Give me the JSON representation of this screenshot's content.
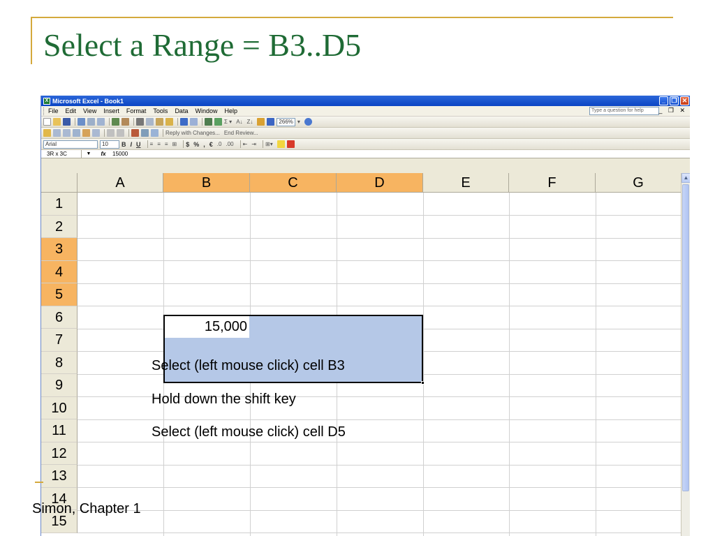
{
  "slide": {
    "title": "Select a Range = B3..D5",
    "footer": "Simon, Chapter 1"
  },
  "window": {
    "title": "Microsoft Excel - Book1",
    "help_placeholder": "Type a question for help"
  },
  "menu": {
    "items": [
      "File",
      "Edit",
      "View",
      "Insert",
      "Format",
      "Tools",
      "Data",
      "Window",
      "Help"
    ]
  },
  "toolbar": {
    "zoom": "266%",
    "reply_with_changes": "Reply with Changes...",
    "end_review": "End Review...",
    "font_name": "Arial",
    "font_size": "10",
    "bold": "B",
    "italic": "I",
    "underline": "U",
    "currency": "$",
    "percent": "%",
    "euro": "€"
  },
  "formula_bar": {
    "name_box": "3R x 3C",
    "fx": "fx",
    "value": "15000"
  },
  "sheet": {
    "columns": [
      "A",
      "B",
      "C",
      "D",
      "E",
      "F",
      "G"
    ],
    "rows": [
      "1",
      "2",
      "3",
      "4",
      "5",
      "6",
      "7",
      "8",
      "9",
      "10",
      "11",
      "12",
      "13",
      "14",
      "15"
    ],
    "selected_columns": [
      "B",
      "C",
      "D"
    ],
    "selected_rows": [
      "3",
      "4",
      "5"
    ],
    "selection_range": "B3..D5",
    "cell_b3": "15,000"
  },
  "instructions": [
    "Select (left mouse click) cell B3",
    "Hold down the shift key",
    "Select (left mouse click) cell D5"
  ],
  "colors": {
    "title_green": "#1f6b35",
    "accent_gold": "#d4a93c",
    "selection_fill": "#b5c8e7",
    "header_highlight": "#f7b461",
    "titlebar_blue": "#0a45c4"
  }
}
